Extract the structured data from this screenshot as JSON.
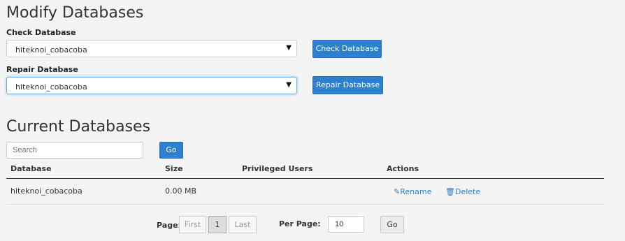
{
  "modify": {
    "title": "Modify Databases",
    "check": {
      "label": "Check Database",
      "selected": "hiteknoi_cobacoba",
      "button": "Check Database"
    },
    "repair": {
      "label": "Repair Database",
      "selected": "hiteknoi_cobacoba",
      "button": "Repair Database"
    }
  },
  "current": {
    "title": "Current Databases",
    "search_placeholder": "Search",
    "go_label": "Go",
    "columns": [
      "Database",
      "Size",
      "Privileged Users",
      "Actions"
    ],
    "rows": [
      {
        "database": "hiteknoi_cobacoba",
        "size": "0.00 MB",
        "users": "",
        "rename": "Rename",
        "delete": "Delete"
      }
    ]
  },
  "pagination": {
    "page_label": "Page:",
    "first": "First",
    "current_page": "1",
    "last": "Last",
    "per_page_label": "Per Page:",
    "per_page_value": "10",
    "go_label": "Go"
  },
  "colors": {
    "primary": "#2d7fd0",
    "background": "#f4f4f4"
  },
  "icons": [
    "caret-down-icon",
    "pencil-icon",
    "trash-icon"
  ]
}
